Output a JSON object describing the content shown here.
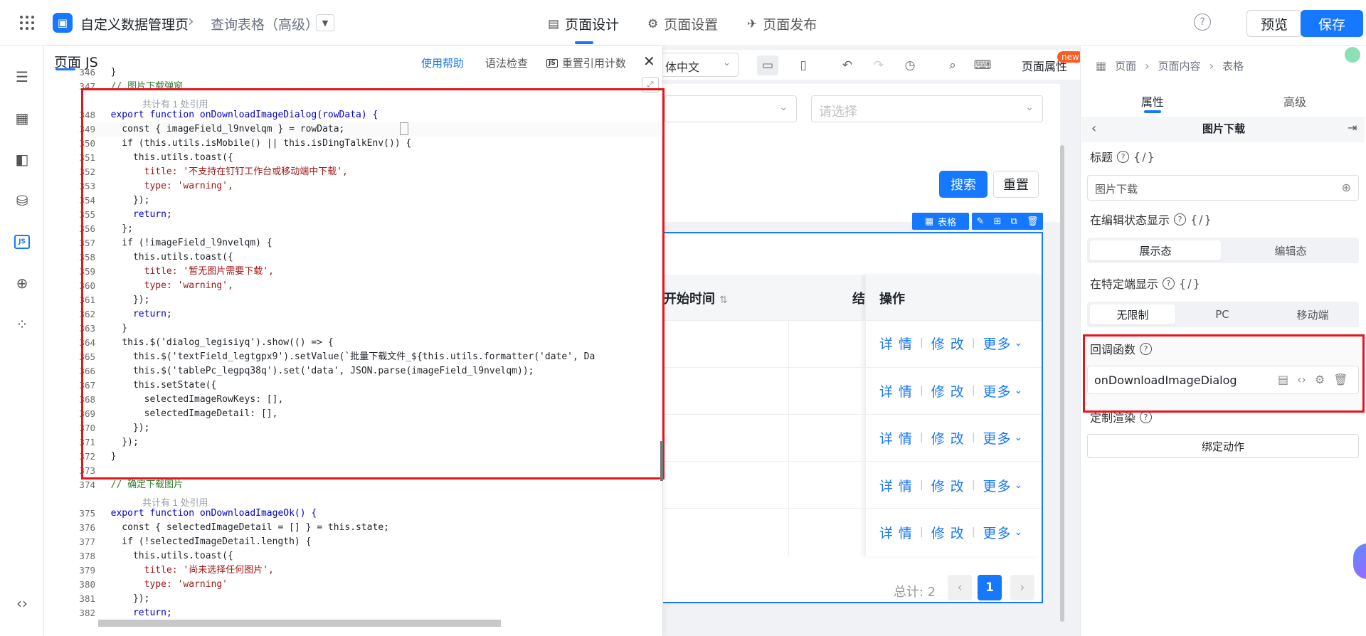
{
  "topbar": {
    "app_title": "自定义数据管理页",
    "page_name": "查询表格（高级）",
    "tabs": [
      {
        "label": "页面设计",
        "icon": "layout-icon",
        "active": true
      },
      {
        "label": "页面设置",
        "icon": "gear-icon",
        "active": false
      },
      {
        "label": "页面发布",
        "icon": "send-icon",
        "active": false
      }
    ],
    "preview_label": "预览",
    "save_label": "保存",
    "accent_color": "#1677ff"
  },
  "leftbar": {
    "icons": [
      "outline-icon",
      "components-icon",
      "layout-icon",
      "datasource-icon",
      "js-icon",
      "globe-icon",
      "apps-icon",
      "code-icon"
    ]
  },
  "js_panel": {
    "title": "页面 JS",
    "help_label": "使用帮助",
    "lint_label": "语法检查",
    "reset_label": "重置引用计数",
    "lines": [
      {
        "no": "346",
        "text": "  }"
      },
      {
        "no": "347",
        "text": "  // 图片下载弹窗"
      },
      {
        "no": "348",
        "text": "  export function onDownloadImageDialog(rowData) {"
      },
      {
        "no": "349",
        "text": "    const { imageField_l9nvelqm } = rowData;"
      },
      {
        "no": "350",
        "text": "    if (this.utils.isMobile() || this.isDingTalkEnv()) {"
      },
      {
        "no": "351",
        "text": "      this.utils.toast({"
      },
      {
        "no": "352",
        "text": "        title: '不支持在钉钉工作台或移动端中下载',"
      },
      {
        "no": "353",
        "text": "        type: 'warning',"
      },
      {
        "no": "354",
        "text": "      });"
      },
      {
        "no": "355",
        "text": "      return;"
      },
      {
        "no": "356",
        "text": "    };"
      },
      {
        "no": "357",
        "text": "    if (!imageField_l9nvelqm) {"
      },
      {
        "no": "358",
        "text": "      this.utils.toast({"
      },
      {
        "no": "359",
        "text": "        title: '暂无图片需要下载',"
      },
      {
        "no": "360",
        "text": "        type: 'warning',"
      },
      {
        "no": "361",
        "text": "      });"
      },
      {
        "no": "362",
        "text": "      return;"
      },
      {
        "no": "363",
        "text": "    }"
      },
      {
        "no": "364",
        "text": "    this.$('dialog_legisiyq').show(() => {"
      },
      {
        "no": "365",
        "text": "      this.$('textField_legtgpx9').setValue(`批量下载文件_${this.utils.formatter('date', Da"
      },
      {
        "no": "366",
        "text": "      this.$('tablePc_legpq38q').set('data', JSON.parse(imageField_l9nvelqm));"
      },
      {
        "no": "367",
        "text": "      this.setState({"
      },
      {
        "no": "368",
        "text": "        selectedImageRowKeys: [],"
      },
      {
        "no": "369",
        "text": "        selectedImageDetail: [],"
      },
      {
        "no": "370",
        "text": "      });"
      },
      {
        "no": "371",
        "text": "    });"
      },
      {
        "no": "372",
        "text": "  }"
      },
      {
        "no": "373",
        "text": ""
      },
      {
        "no": "374",
        "text": "  // 确定下载图片"
      },
      {
        "no": "375",
        "text": "  export function onDownloadImageOk() {"
      },
      {
        "no": "376",
        "text": "    const { selectedImageDetail = [] } = this.state;"
      },
      {
        "no": "377",
        "text": "    if (!selectedImageDetail.length) {"
      },
      {
        "no": "378",
        "text": "      this.utils.toast({"
      },
      {
        "no": "379",
        "text": "        title: '尚未选择任何图片',"
      },
      {
        "no": "380",
        "text": "        type: 'warning'"
      },
      {
        "no": "381",
        "text": "      });"
      },
      {
        "no": "382",
        "text": "      return;"
      }
    ],
    "ref_note_1": "共计有 1 处引用",
    "ref_note_2": "共计有 1 处引用"
  },
  "canvas": {
    "lang_select": "体中文",
    "page_attr_label": "页面属性",
    "new_badge": "new",
    "select_placeholder": "请选择",
    "search_label": "搜索",
    "reset_label": "重置",
    "table_tag_label": "表格",
    "columns": {
      "start": "开始时间",
      "end": "结",
      "op": "操作"
    },
    "row_actions": [
      {
        "detail": "详 情",
        "edit": "修 改",
        "more": "更多"
      },
      {
        "detail": "详 情",
        "edit": "修 改",
        "more": "更多"
      },
      {
        "detail": "详 情",
        "edit": "修 改",
        "more": "更多"
      },
      {
        "detail": "详 情",
        "edit": "修 改",
        "more": "更多"
      },
      {
        "detail": "详 情",
        "edit": "修 改",
        "more": "更多"
      }
    ],
    "total_label": "总计: 2",
    "current_page": "1"
  },
  "right_panel": {
    "crumbs": [
      "页面",
      "页面内容",
      "表格"
    ],
    "tabs": [
      "属性",
      "高级"
    ],
    "subtitle": "图片下载",
    "title_label": "标题",
    "title_value": "图片下载",
    "edit_state_label": "在编辑状态显示",
    "edit_state_options": [
      "展示态",
      "编辑态"
    ],
    "device_label": "在特定端显示",
    "device_options": [
      "无限制",
      "PC",
      "移动端"
    ],
    "callback_label": "回调函数",
    "callback_value": "onDownloadImageDialog",
    "custom_render_label": "定制渲染",
    "bind_action_label": "绑定动作",
    "var_tag": "{/}"
  }
}
